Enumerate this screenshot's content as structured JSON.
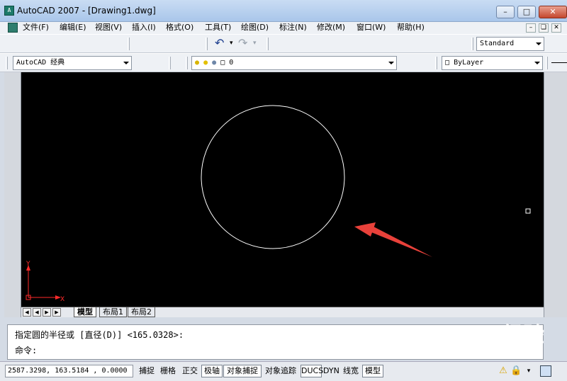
{
  "window": {
    "title": "AutoCAD 2007 - [Drawing1.dwg]",
    "app_icon_label": "A"
  },
  "menu": {
    "items": [
      "文件(F)",
      "编辑(E)",
      "视图(V)",
      "插入(I)",
      "格式(O)",
      "工具(T)",
      "绘图(D)",
      "标注(N)",
      "修改(M)",
      "窗口(W)",
      "帮助(H)"
    ]
  },
  "toolbar": {
    "text_style": "Standard",
    "workspace": "AutoCAD 经典",
    "layer": "0",
    "color": "ByLayer"
  },
  "drawing": {
    "background_color": "#000000",
    "entity": "circle",
    "stroke_color": "#ffffff",
    "annotation_arrow_color": "#e8413a",
    "ucs_color": "#ff2a2a",
    "ucs_x_label": "X",
    "ucs_y_label": "Y"
  },
  "tabs": {
    "items": [
      "模型",
      "布局1",
      "布局2"
    ],
    "active": "模型"
  },
  "command_window": {
    "line1": "指定圆的半径或 [直径(D)] <165.0328>:",
    "line2": "命令:"
  },
  "status_bar": {
    "coordinates": "2587.3298, 163.5184 , 0.0000",
    "buttons": [
      "捕捉",
      "栅格",
      "正交",
      "极轴",
      "对象捕捉",
      "对象追踪",
      "DUCS",
      "DYN",
      "线宽",
      "模型"
    ]
  },
  "watermark": {
    "text": "Baidu经验",
    "sub": "jingyan.baidu.com"
  }
}
